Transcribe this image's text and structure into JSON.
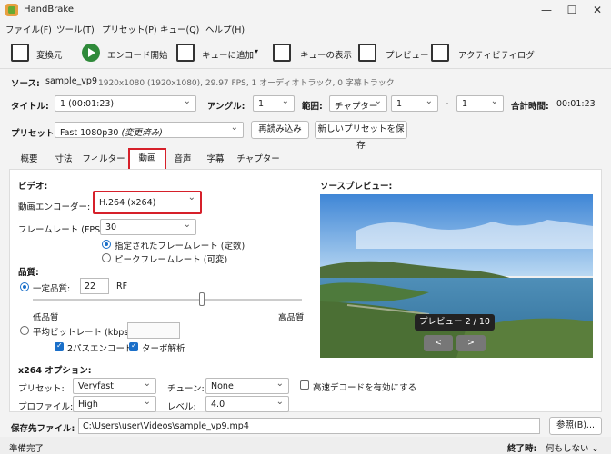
{
  "app": {
    "title": "HandBrake"
  },
  "window": {
    "minimize": "—",
    "maximize": "☐",
    "close": "✕"
  },
  "menu": [
    "ファイル(F)",
    "ツール(T)",
    "プリセット(P)",
    "キュー(Q)",
    "ヘルプ(H)"
  ],
  "toolbar": {
    "convert": "変換元",
    "start": "エンコード開始",
    "add_queue": "キューに追加",
    "show_queue": "キューの表示",
    "preview": "プレビュー",
    "activity": "アクティビティログ"
  },
  "source": {
    "label": "ソース:",
    "name": "sample_vp9",
    "info": "1920x1080 (1920x1080), 29.97 FPS, 1 オーディオトラック, 0 字幕トラック"
  },
  "title_row": {
    "title_label": "タイトル:",
    "title_value": "1 (00:01:23)",
    "angle_label": "アングル:",
    "angle_value": "1",
    "range_label": "範囲:",
    "range_type": "チャプター",
    "range_from": "1",
    "range_sep": "-",
    "range_to": "1",
    "total_label": "合計時間:",
    "total_value": "00:01:23"
  },
  "preset_row": {
    "label": "プリセット:",
    "value": "Fast 1080p30",
    "modified": "(変更済み)",
    "reload": "再読み込み",
    "save_new": "新しいプリセットを保存"
  },
  "tabs": [
    "概要",
    "寸法",
    "フィルター",
    "動画",
    "音声",
    "字幕",
    "チャプター"
  ],
  "video": {
    "section": "ビデオ:",
    "encoder_label": "動画エンコーダー:",
    "encoder_value": "H.264 (x264)",
    "fps_label": "フレームレート (FPS):",
    "fps_value": "30",
    "fps_constant": "指定されたフレームレート (定数)",
    "fps_peak": "ピークフレームレート (可変)"
  },
  "quality": {
    "section": "品質:",
    "cq_label": "一定品質:",
    "cq_value": "22",
    "rf": "RF",
    "low": "低品質",
    "high": "高品質",
    "slider_level": 0.63,
    "abr_label": "平均ビットレート (kbps):",
    "twopass": "2パスエンコード",
    "turbo": "ターボ解析"
  },
  "preview": {
    "label": "ソースプレビュー:",
    "counter": "プレビュー 2 / 10",
    "prev": "<",
    "next": ">"
  },
  "x264": {
    "section": "x264 オプション:",
    "preset_label": "プリセット:",
    "preset_value": "Veryfast",
    "tune_label": "チューン:",
    "tune_value": "None",
    "fastdecode": "高速デコードを有効にする",
    "profile_label": "プロファイル:",
    "profile_value": "High",
    "level_label": "レベル:",
    "level_value": "4.0"
  },
  "destination": {
    "label": "保存先ファイル:",
    "path": "C:\\Users\\user\\Videos\\sample_vp9.mp4",
    "browse": "参照(B)..."
  },
  "status": {
    "left": "準備完了",
    "done_label": "終了時:",
    "done_value": "何もしない"
  }
}
